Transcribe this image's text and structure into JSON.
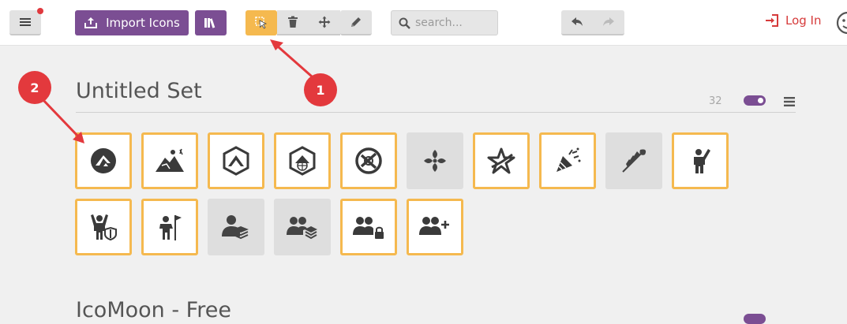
{
  "toolbar": {
    "menu_icon": "hamburger-icon",
    "import_label": "Import Icons",
    "library_icon": "library-books-icon",
    "tools": [
      {
        "name": "select",
        "icon": "select-cursor-icon",
        "active": true
      },
      {
        "name": "delete",
        "icon": "trash-icon",
        "active": false
      },
      {
        "name": "move",
        "icon": "move-arrows-icon",
        "active": false
      },
      {
        "name": "edit",
        "icon": "pencil-icon",
        "active": false
      }
    ],
    "search_placeholder": "search...",
    "undo_icon": "undo-icon",
    "redo_icon": "redo-icon",
    "login_label": "Log In",
    "accent_color": "#7b4e93",
    "highlight_color": "#f5b94f",
    "login_color": "#d63b3b"
  },
  "icon_set": {
    "title": "Untitled Set",
    "count": "32",
    "enabled": true,
    "icons": [
      {
        "name": "circle-logo-icon",
        "selected": true
      },
      {
        "name": "mountain-climb-icon",
        "selected": true
      },
      {
        "name": "hexagon-mountain-icon",
        "selected": true
      },
      {
        "name": "hexagon-globe-icon",
        "selected": true
      },
      {
        "name": "circle-knot-icon",
        "selected": true
      },
      {
        "name": "ornament-icon",
        "selected": false
      },
      {
        "name": "star-swoosh-icon",
        "selected": true
      },
      {
        "name": "party-popper-icon",
        "selected": true
      },
      {
        "name": "wheat-icon",
        "selected": false
      },
      {
        "name": "person-waving-icon",
        "selected": true
      },
      {
        "name": "person-shield-icon",
        "selected": true
      },
      {
        "name": "person-flag-icon",
        "selected": true
      },
      {
        "name": "person-layers-icon",
        "selected": false
      },
      {
        "name": "group-layers-icon",
        "selected": false
      },
      {
        "name": "group-lock-icon",
        "selected": true
      },
      {
        "name": "group-add-icon",
        "selected": true
      }
    ]
  },
  "next_set": {
    "title": "IcoMoon - Free"
  },
  "annotations": [
    {
      "label": "1",
      "color": "#e3393d"
    },
    {
      "label": "2",
      "color": "#e3393d"
    }
  ]
}
